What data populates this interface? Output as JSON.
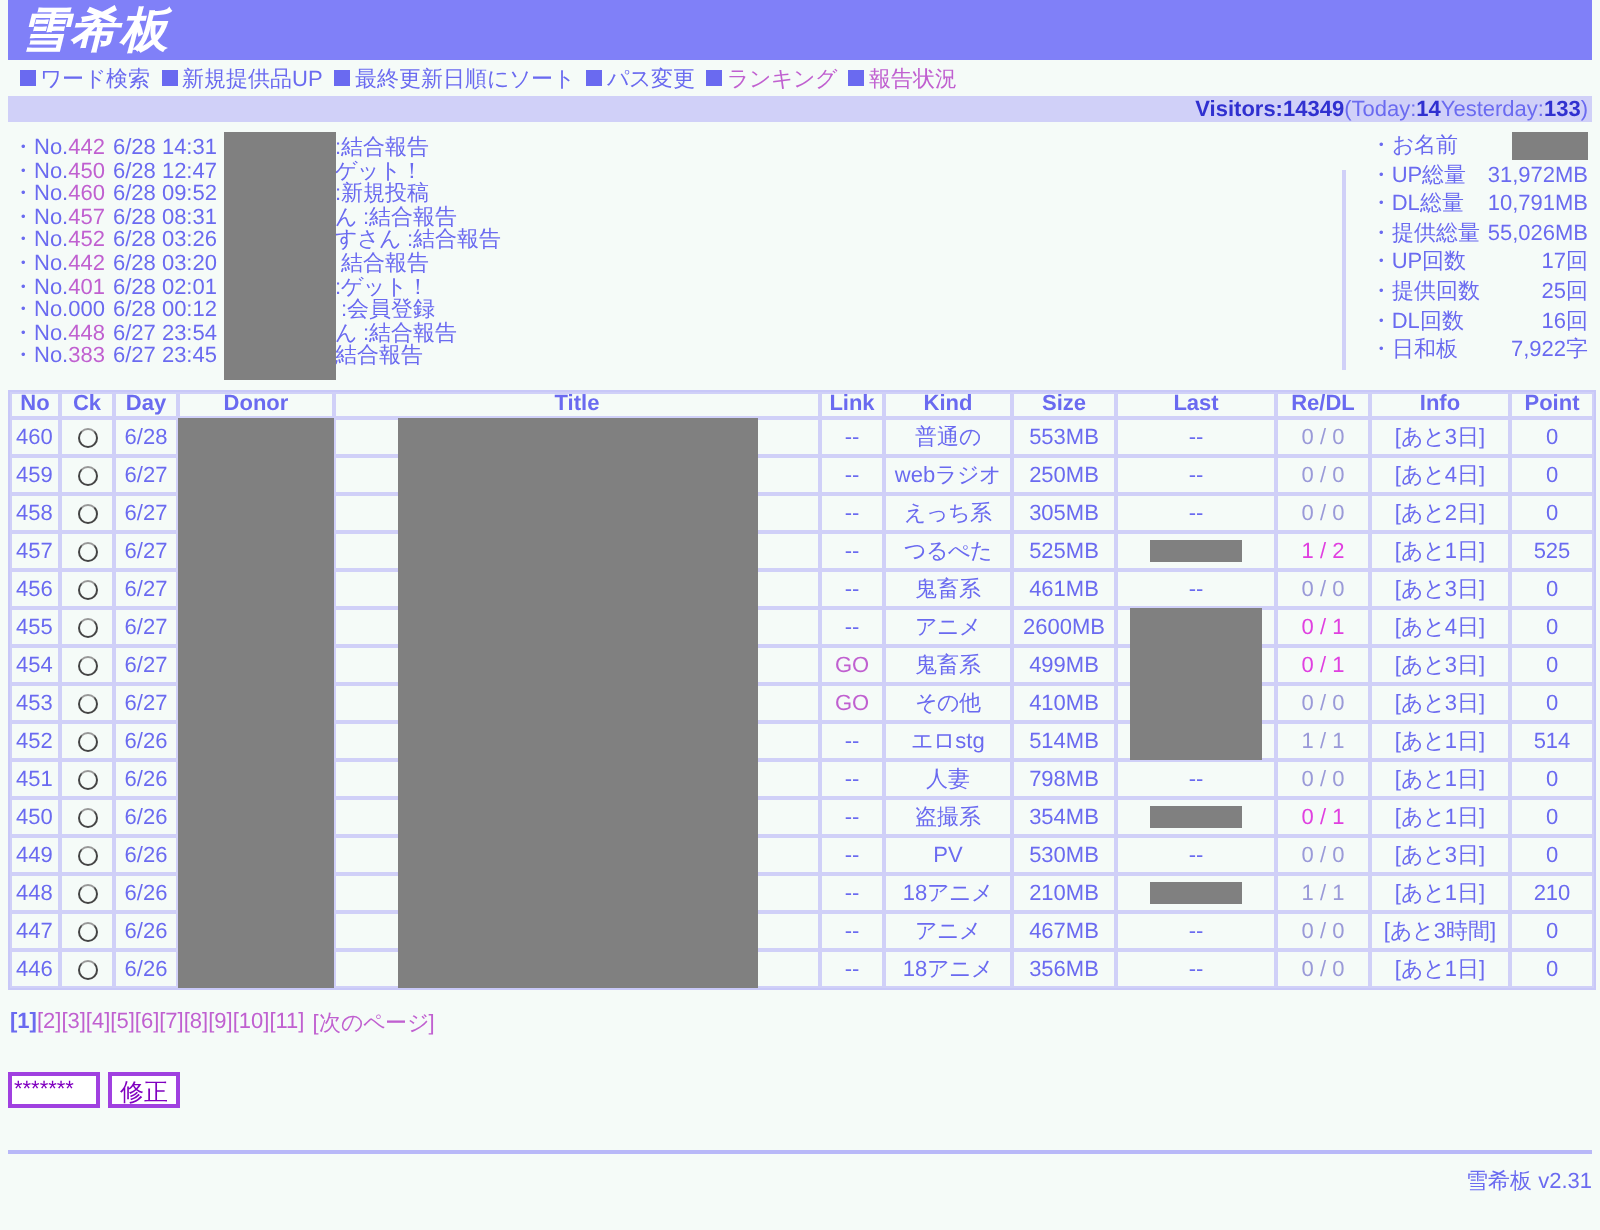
{
  "header": {
    "logo": "雪希板"
  },
  "menu": [
    {
      "label": "ワード検索",
      "visited": false
    },
    {
      "label": "新規提供品UP",
      "visited": false
    },
    {
      "label": "最終更新日順にソート",
      "visited": false
    },
    {
      "label": "パス変更",
      "visited": false
    },
    {
      "label": "ランキング",
      "visited": true
    },
    {
      "label": "報告状況",
      "visited": true
    }
  ],
  "visitors": "**Visitors:14349**(Today:**14**Yesterday:**133**)",
  "recent": [
    {
      "prefix": "・No.",
      "no": "442",
      "linked": true,
      "datetime": "6/28 14:31",
      "text": ":結合報告"
    },
    {
      "prefix": "・No.",
      "no": "450",
      "linked": true,
      "datetime": "6/28 12:47",
      "text": "ゲット！"
    },
    {
      "prefix": "・No.",
      "no": "460",
      "linked": true,
      "datetime": "6/28 09:52",
      "text": ":新規投稿"
    },
    {
      "prefix": "・No.",
      "no": "457",
      "linked": true,
      "datetime": "6/28 08:31",
      "text": "ん :結合報告"
    },
    {
      "prefix": "・No.",
      "no": "452",
      "linked": true,
      "datetime": "6/28 03:26",
      "text": "すさん :結合報告"
    },
    {
      "prefix": "・No.",
      "no": "442",
      "linked": true,
      "datetime": "6/28 03:20",
      "text": " 結合報告"
    },
    {
      "prefix": "・No.",
      "no": "401",
      "linked": true,
      "datetime": "6/28 02:01",
      "text": ":ゲット！"
    },
    {
      "prefix": "・No.",
      "no": "000",
      "linked": false,
      "datetime": "6/28 00:12",
      "text": " :会員登録"
    },
    {
      "prefix": "・No.",
      "no": "448",
      "linked": true,
      "datetime": "6/27 23:54",
      "text": "ん :結合報告"
    },
    {
      "prefix": "・No.",
      "no": "383",
      "linked": true,
      "datetime": "6/27 23:45",
      "text": "結合報告"
    }
  ],
  "stats": [
    {
      "label": "・お名前",
      "redacted": true
    },
    {
      "label": "・UP総量",
      "value": "31,972MB"
    },
    {
      "label": "・DL総量",
      "value": "10,791MB"
    },
    {
      "label": "・提供総量",
      "value": "55,026MB"
    },
    {
      "label": "・UP回数",
      "value": "17回"
    },
    {
      "label": "・提供回数",
      "value": "25回"
    },
    {
      "label": "・DL回数",
      "value": "16回"
    },
    {
      "label": "・日和板",
      "value": "7,922字"
    }
  ],
  "table": {
    "columns": [
      "No",
      "Ck",
      "Day",
      "Donor",
      "Title",
      "Link",
      "Kind",
      "Size",
      "Last",
      "Re/DL",
      "Info",
      "Point"
    ],
    "rows": [
      {
        "no": "460",
        "checked": false,
        "day": "6/28",
        "link": "--",
        "link_active": false,
        "kind": "普通の",
        "size": "553MB",
        "last": {
          "kind": "text",
          "text": "--"
        },
        "re_dl": {
          "text": "0 / 0",
          "color": "#9a9ad8"
        },
        "info": "[あと3日]",
        "point": "0"
      },
      {
        "no": "459",
        "checked": false,
        "day": "6/27",
        "link": "--",
        "link_active": false,
        "kind": "webラジオ",
        "size": "250MB",
        "last": {
          "kind": "text",
          "text": "--"
        },
        "re_dl": {
          "text": "0 / 0",
          "color": "#9a9ad8"
        },
        "info": "[あと4日]",
        "point": "0"
      },
      {
        "no": "458",
        "checked": false,
        "day": "6/27",
        "link": "--",
        "link_active": false,
        "kind": "えっち系",
        "size": "305MB",
        "last": {
          "kind": "text",
          "text": "--"
        },
        "re_dl": {
          "text": "0 / 0",
          "color": "#9a9ad8"
        },
        "info": "[あと2日]",
        "point": "0"
      },
      {
        "no": "457",
        "checked": false,
        "day": "6/27",
        "link": "--",
        "link_active": false,
        "kind": "つるぺた",
        "size": "525MB",
        "last": {
          "kind": "bar"
        },
        "re_dl": {
          "text": "1 / 2",
          "color": "#e040e0"
        },
        "info": "[あと1日]",
        "point": "525"
      },
      {
        "no": "456",
        "checked": false,
        "day": "6/27",
        "link": "--",
        "link_active": false,
        "kind": "鬼畜系",
        "size": "461MB",
        "last": {
          "kind": "text",
          "text": "--"
        },
        "re_dl": {
          "text": "0 / 0",
          "color": "#9a9ad8"
        },
        "info": "[あと3日]",
        "point": "0"
      },
      {
        "no": "455",
        "checked": false,
        "day": "6/27",
        "link": "--",
        "link_active": false,
        "kind": "アニメ",
        "size": "2600MB",
        "last": {
          "kind": "block"
        },
        "re_dl": {
          "text": "0 / 1",
          "color": "#e040e0"
        },
        "info": "[あと4日]",
        "point": "0"
      },
      {
        "no": "454",
        "checked": false,
        "day": "6/27",
        "link": "GO",
        "link_active": true,
        "kind": "鬼畜系",
        "size": "499MB",
        "last": {
          "kind": "block"
        },
        "re_dl": {
          "text": "0 / 1",
          "color": "#e040e0"
        },
        "info": "[あと3日]",
        "point": "0"
      },
      {
        "no": "453",
        "checked": false,
        "day": "6/27",
        "link": "GO",
        "link_active": true,
        "kind": "その他",
        "size": "410MB",
        "last": {
          "kind": "block"
        },
        "re_dl": {
          "text": "0 / 0",
          "color": "#9a9ad8"
        },
        "info": "[あと3日]",
        "point": "0"
      },
      {
        "no": "452",
        "checked": false,
        "day": "6/26",
        "link": "--",
        "link_active": false,
        "kind": "エロstg",
        "size": "514MB",
        "last": {
          "kind": "block"
        },
        "re_dl": {
          "text": "1 / 1",
          "color": "#9a9ad8"
        },
        "info": "[あと1日]",
        "point": "514"
      },
      {
        "no": "451",
        "checked": false,
        "day": "6/26",
        "link": "--",
        "link_active": false,
        "kind": "人妻",
        "size": "798MB",
        "last": {
          "kind": "text",
          "text": "--"
        },
        "re_dl": {
          "text": "0 / 0",
          "color": "#9a9ad8"
        },
        "info": "[あと1日]",
        "point": "0"
      },
      {
        "no": "450",
        "checked": false,
        "day": "6/26",
        "link": "--",
        "link_active": false,
        "kind": "盗撮系",
        "size": "354MB",
        "last": {
          "kind": "bar"
        },
        "re_dl": {
          "text": "0 / 1",
          "color": "#e040e0"
        },
        "info": "[あと1日]",
        "point": "0"
      },
      {
        "no": "449",
        "checked": false,
        "day": "6/26",
        "link": "--",
        "link_active": false,
        "kind": "PV",
        "size": "530MB",
        "last": {
          "kind": "text",
          "text": "--"
        },
        "re_dl": {
          "text": "0 / 0",
          "color": "#9a9ad8"
        },
        "info": "[あと3日]",
        "point": "0"
      },
      {
        "no": "448",
        "checked": false,
        "day": "6/26",
        "link": "--",
        "link_active": false,
        "kind": "18アニメ",
        "size": "210MB",
        "last": {
          "kind": "bar"
        },
        "re_dl": {
          "text": "1 / 1",
          "color": "#9a9ad8"
        },
        "info": "[あと1日]",
        "point": "210"
      },
      {
        "no": "447",
        "checked": false,
        "day": "6/26",
        "link": "--",
        "link_active": false,
        "kind": "アニメ",
        "size": "467MB",
        "last": {
          "kind": "text",
          "text": "--"
        },
        "re_dl": {
          "text": "0 / 0",
          "color": "#9a9ad8"
        },
        "info": "[あと3時間]",
        "point": "0"
      },
      {
        "no": "446",
        "checked": false,
        "day": "6/26",
        "link": "--",
        "link_active": false,
        "kind": "18アニメ",
        "size": "356MB",
        "last": {
          "kind": "text",
          "text": "--"
        },
        "re_dl": {
          "text": "0 / 0",
          "color": "#9a9ad8"
        },
        "info": "[あと1日]",
        "point": "0"
      }
    ]
  },
  "pages": [
    {
      "text": "[1]",
      "selected": true
    },
    {
      "text": "[2]",
      "selected": false
    },
    {
      "text": "[3]",
      "selected": false
    },
    {
      "text": "[4]",
      "selected": false
    },
    {
      "text": "[5]",
      "selected": false
    },
    {
      "text": "[6]",
      "selected": false
    },
    {
      "text": "[7]",
      "selected": false
    },
    {
      "text": "[8]",
      "selected": false
    },
    {
      "text": "[9]",
      "selected": false
    },
    {
      "text": "[10]",
      "selected": false
    },
    {
      "text": "[11]",
      "selected": false
    }
  ],
  "next_page": "[次のページ]",
  "password": {
    "value": "*******"
  },
  "submit": "修正",
  "footer": "雪希板 v2.31"
}
